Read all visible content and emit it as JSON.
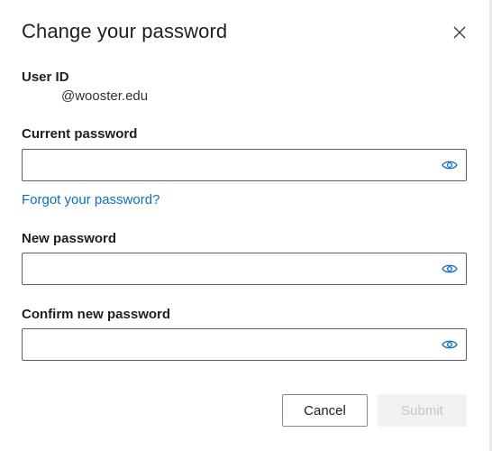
{
  "dialog": {
    "title": "Change your password",
    "close_icon": "close-icon"
  },
  "user_id": {
    "label": "User ID",
    "value": "@wooster.edu"
  },
  "current_password": {
    "label": "Current password",
    "value": "",
    "icon": "eye-icon"
  },
  "forgot_link": "Forgot your password?",
  "new_password": {
    "label": "New password",
    "value": "",
    "icon": "eye-icon"
  },
  "confirm_password": {
    "label": "Confirm new password",
    "value": "",
    "icon": "eye-icon"
  },
  "buttons": {
    "cancel": "Cancel",
    "submit": "Submit"
  },
  "colors": {
    "accent": "#0f6cbd",
    "text": "#201f1e",
    "border": "#605e5c",
    "disabled_bg": "#f3f2f1",
    "disabled_text": "#c8c6c4"
  }
}
